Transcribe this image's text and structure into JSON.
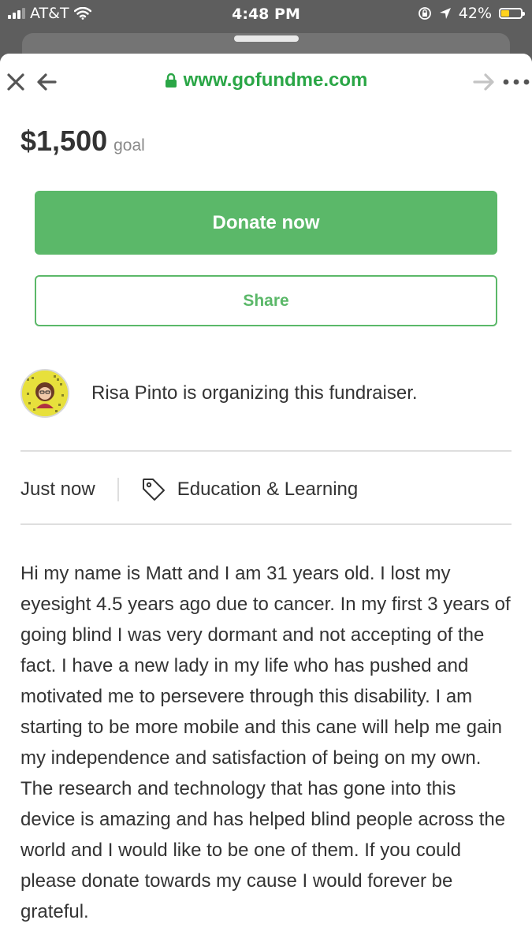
{
  "status_bar": {
    "carrier": "AT&T",
    "time": "4:48 PM",
    "battery_percent_text": "42%",
    "battery_level": 0.42,
    "battery_color": "#ffd21e",
    "icons": [
      "signal-icon",
      "wifi-icon",
      "orientation-lock-icon",
      "location-icon",
      "battery-icon"
    ]
  },
  "browser": {
    "url": "www.gofundme.com",
    "icons": [
      "close-icon",
      "back-arrow-icon",
      "lock-icon",
      "forward-arrow-icon",
      "more-icon"
    ],
    "accent_color": "#2aa646"
  },
  "campaign": {
    "goal_amount": "$1,500",
    "goal_label": "goal",
    "donate_label": "Donate now",
    "share_label": "Share",
    "brand_color": "#5bb869",
    "organizer_text": "Risa Pinto is organizing this fundraiser.",
    "created": "Just now",
    "category": "Education & Learning",
    "category_icon": "tag-icon",
    "story": "Hi my name is Matt and I am 31 years old. I lost my eyesight 4.5 years ago due to cancer. In my first 3 years of going blind I was very dormant and not accepting of the fact. I have a new lady in my life who has pushed and motivated me to persevere through this disability. I am starting to be more mobile and this cane will help me gain my independence and satisfaction of being on my own. The research and technology that has gone into this device is amazing and has helped blind people across the world and I would like to be one of them. If you could please donate towards my cause I would forever be grateful."
  }
}
